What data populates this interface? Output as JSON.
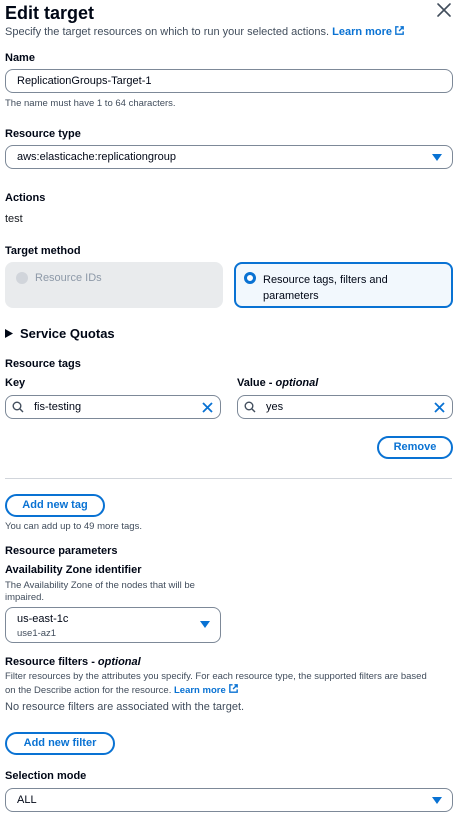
{
  "header": {
    "title": "Edit target",
    "subtitle": "Specify the target resources on which to run your selected actions.",
    "learn_more": "Learn more"
  },
  "name": {
    "label": "Name",
    "value": "ReplicationGroups-Target-1",
    "help": "The name must have 1 to 64 characters."
  },
  "resource_type": {
    "label": "Resource type",
    "value": "aws:elasticache:replicationgroup"
  },
  "actions": {
    "label": "Actions",
    "value": "test"
  },
  "target_method": {
    "label": "Target method",
    "option_ids": "Resource IDs",
    "option_tags_line1": "Resource tags, filters and",
    "option_tags_line2": "parameters",
    "selected": "Resource tags, filters and parameters"
  },
  "service_quotas": {
    "label": "Service Quotas"
  },
  "resource_tags": {
    "label": "Resource tags",
    "key_label": "Key",
    "value_label": "Value - ",
    "value_label_optional": "optional",
    "tags": [
      {
        "key": "fis-testing",
        "value": "yes"
      }
    ],
    "remove_button": "Remove",
    "add_button": "Add new tag",
    "limit_help": "You can add up to 49 more tags."
  },
  "resource_parameters": {
    "label": "Resource parameters",
    "az_label": "Availability Zone identifier",
    "az_help_line1": "The Availability Zone of the nodes that will be",
    "az_help_line2": "impaired.",
    "az_value": "us-east-1c",
    "az_sub": "use1-az1"
  },
  "resource_filters": {
    "label": "Resource filters - ",
    "label_optional": "optional",
    "help_line1": "Filter resources by the attributes you specify. For each resource type, the supported filters are based",
    "help_line2": "on the Describe action for the resource.",
    "learn_more": "Learn more",
    "empty": "No resource filters are associated with the target.",
    "add_button": "Add new filter"
  },
  "selection_mode": {
    "label": "Selection mode",
    "value": "ALL"
  },
  "colors": {
    "accent": "#0972d3",
    "text": "#000716",
    "muted": "#414d5c",
    "disabled_bg": "#e9ebed"
  }
}
